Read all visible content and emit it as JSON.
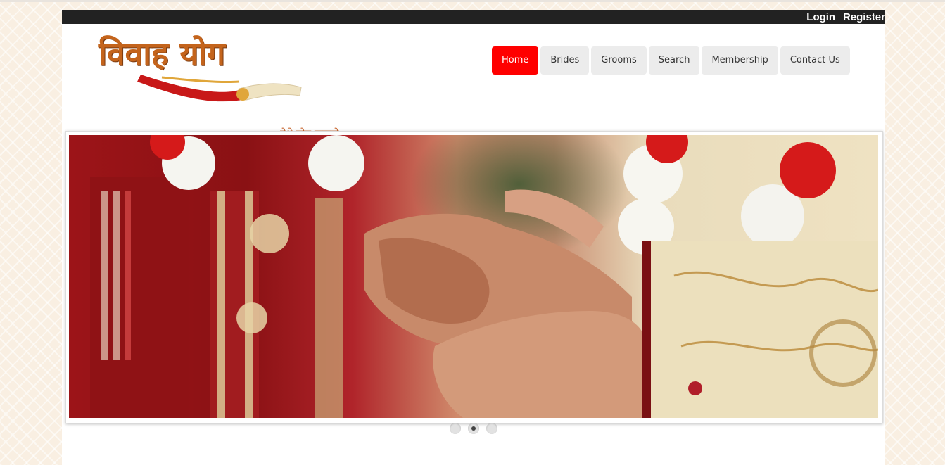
{
  "header": {
    "login_label": "Login",
    "separator": "|",
    "register_label": "Register"
  },
  "logo": {
    "title": "विवाह योग",
    "tagline": "येथे योग जुळतो"
  },
  "nav": {
    "items": [
      {
        "label": "Home",
        "active": true
      },
      {
        "label": "Brides",
        "active": false
      },
      {
        "label": "Grooms",
        "active": false
      },
      {
        "label": "Search",
        "active": false
      },
      {
        "label": "Membership",
        "active": false
      },
      {
        "label": "Contact Us",
        "active": false
      }
    ]
  },
  "slider": {
    "slide_count": 3,
    "active_index": 1
  },
  "colors": {
    "accent": "#ff0000",
    "topbar": "#222222",
    "logo": "#c4641c"
  }
}
